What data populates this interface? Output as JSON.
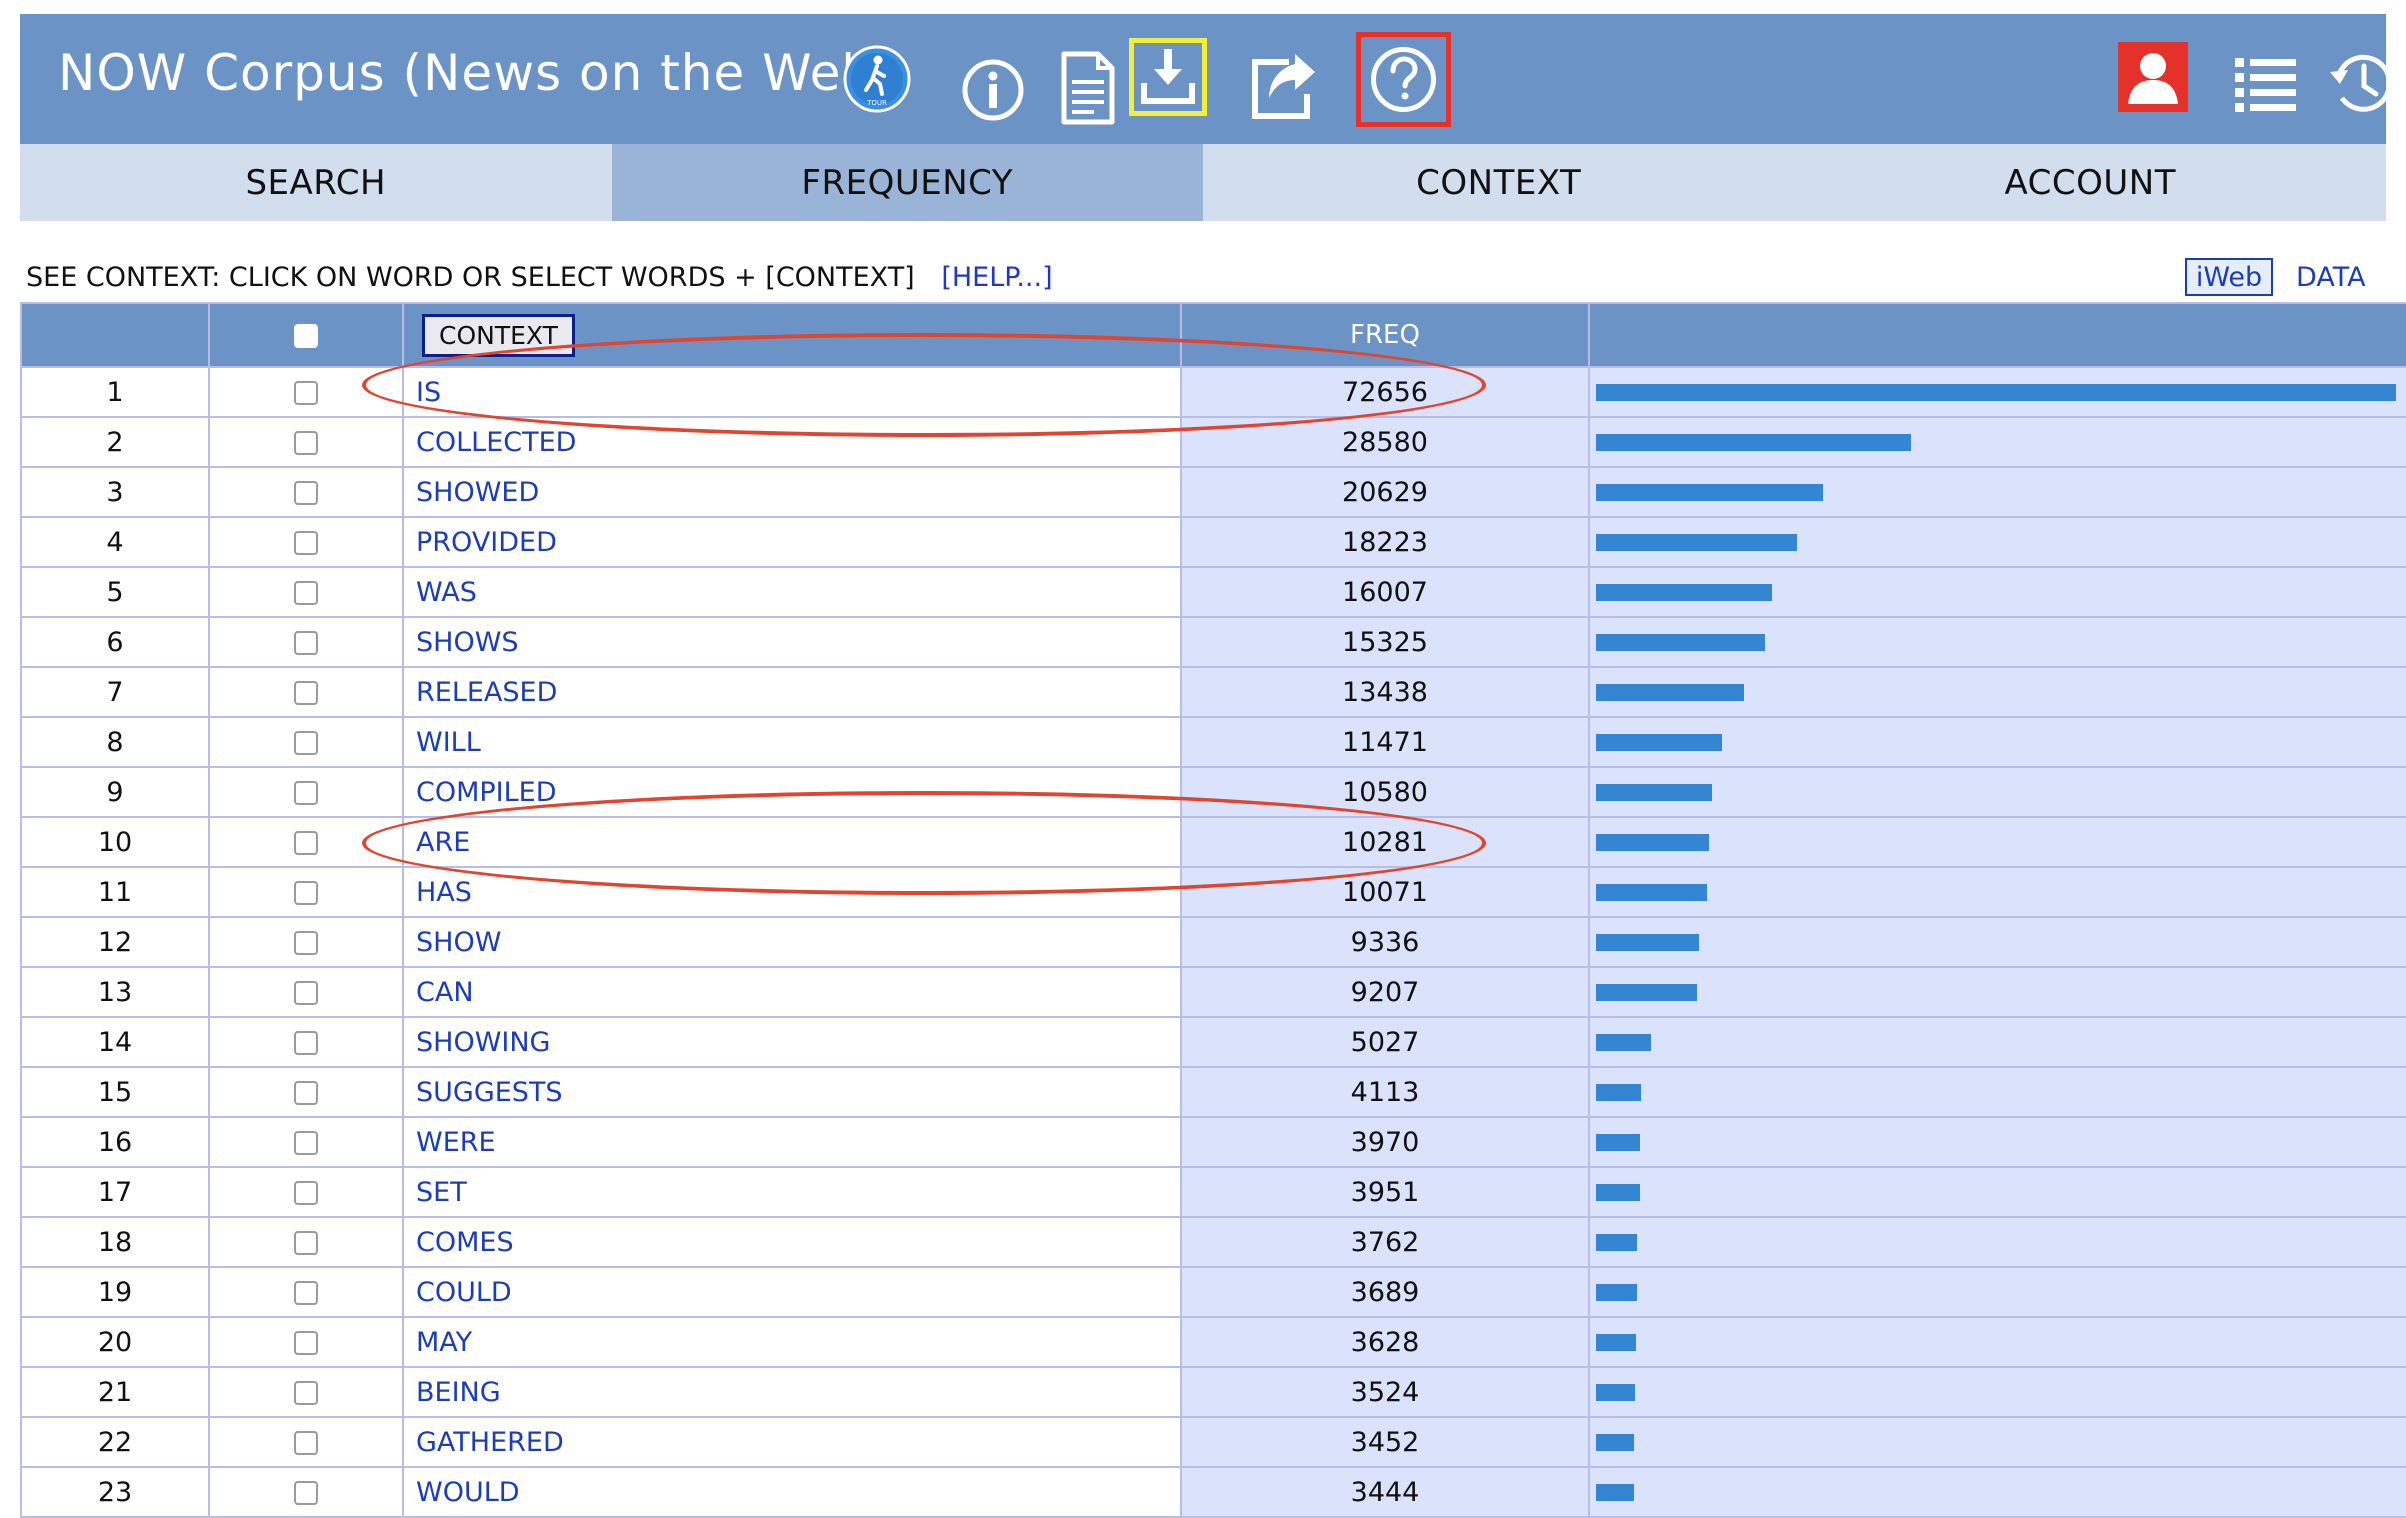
{
  "app": {
    "title": "NOW Corpus (News on the Web)",
    "tour_label": "TOUR"
  },
  "icons": {
    "tour": "tour-icon",
    "info": "info-icon",
    "document": "document-icon",
    "download": "download-icon",
    "share": "share-icon",
    "help": "help-icon",
    "user": "user-icon",
    "list": "list-icon",
    "history": "history-icon"
  },
  "colors": {
    "header": "#6b93c6",
    "tab_active": "#9ab4d8",
    "tab_bg": "#d2dded",
    "link": "#1d3db8",
    "bar": "#3486d3",
    "freq_bg": "#dbe2fb",
    "annotation_red": "#e0452f",
    "download_highlight": "#f2ee3a"
  },
  "tabs": [
    {
      "label": "SEARCH",
      "active": false
    },
    {
      "label": "FREQUENCY",
      "active": true
    },
    {
      "label": "CONTEXT",
      "active": false
    },
    {
      "label": "ACCOUNT",
      "active": false
    }
  ],
  "instructions": {
    "text": "SEE CONTEXT: CLICK ON WORD OR SELECT WORDS + [CONTEXT]",
    "help_link": "[HELP...]",
    "iweb_button": "iWeb",
    "data_link": "DATA"
  },
  "table": {
    "context_button": "CONTEXT",
    "freq_header": "FREQ",
    "rows": [
      {
        "num": "1",
        "word": "IS",
        "freq": 72656
      },
      {
        "num": "2",
        "word": "COLLECTED",
        "freq": 28580
      },
      {
        "num": "3",
        "word": "SHOWED",
        "freq": 20629
      },
      {
        "num": "4",
        "word": "PROVIDED",
        "freq": 18223
      },
      {
        "num": "5",
        "word": "WAS",
        "freq": 16007
      },
      {
        "num": "6",
        "word": "SHOWS",
        "freq": 15325
      },
      {
        "num": "7",
        "word": "RELEASED",
        "freq": 13438
      },
      {
        "num": "8",
        "word": "WILL",
        "freq": 11471
      },
      {
        "num": "9",
        "word": "COMPILED",
        "freq": 10580
      },
      {
        "num": "10",
        "word": "ARE",
        "freq": 10281
      },
      {
        "num": "11",
        "word": "HAS",
        "freq": 10071
      },
      {
        "num": "12",
        "word": "SHOW",
        "freq": 9336
      },
      {
        "num": "13",
        "word": "CAN",
        "freq": 9207
      },
      {
        "num": "14",
        "word": "SHOWING",
        "freq": 5027
      },
      {
        "num": "15",
        "word": "SUGGESTS",
        "freq": 4113
      },
      {
        "num": "16",
        "word": "WERE",
        "freq": 3970
      },
      {
        "num": "17",
        "word": "SET",
        "freq": 3951
      },
      {
        "num": "18",
        "word": "COMES",
        "freq": 3762
      },
      {
        "num": "19",
        "word": "COULD",
        "freq": 3689
      },
      {
        "num": "20",
        "word": "MAY",
        "freq": 3628
      },
      {
        "num": "21",
        "word": "BEING",
        "freq": 3524
      },
      {
        "num": "22",
        "word": "GATHERED",
        "freq": 3452
      },
      {
        "num": "23",
        "word": "WOULD",
        "freq": 3444
      }
    ]
  }
}
